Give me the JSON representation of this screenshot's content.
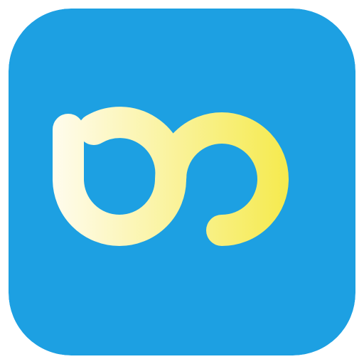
{
  "app_icon": {
    "icon": "infinity-loop-logo-icon",
    "colors": {
      "background": "#1da0e2",
      "gradient_start": "#fffcef",
      "gradient_end": "#f4e83c"
    }
  }
}
